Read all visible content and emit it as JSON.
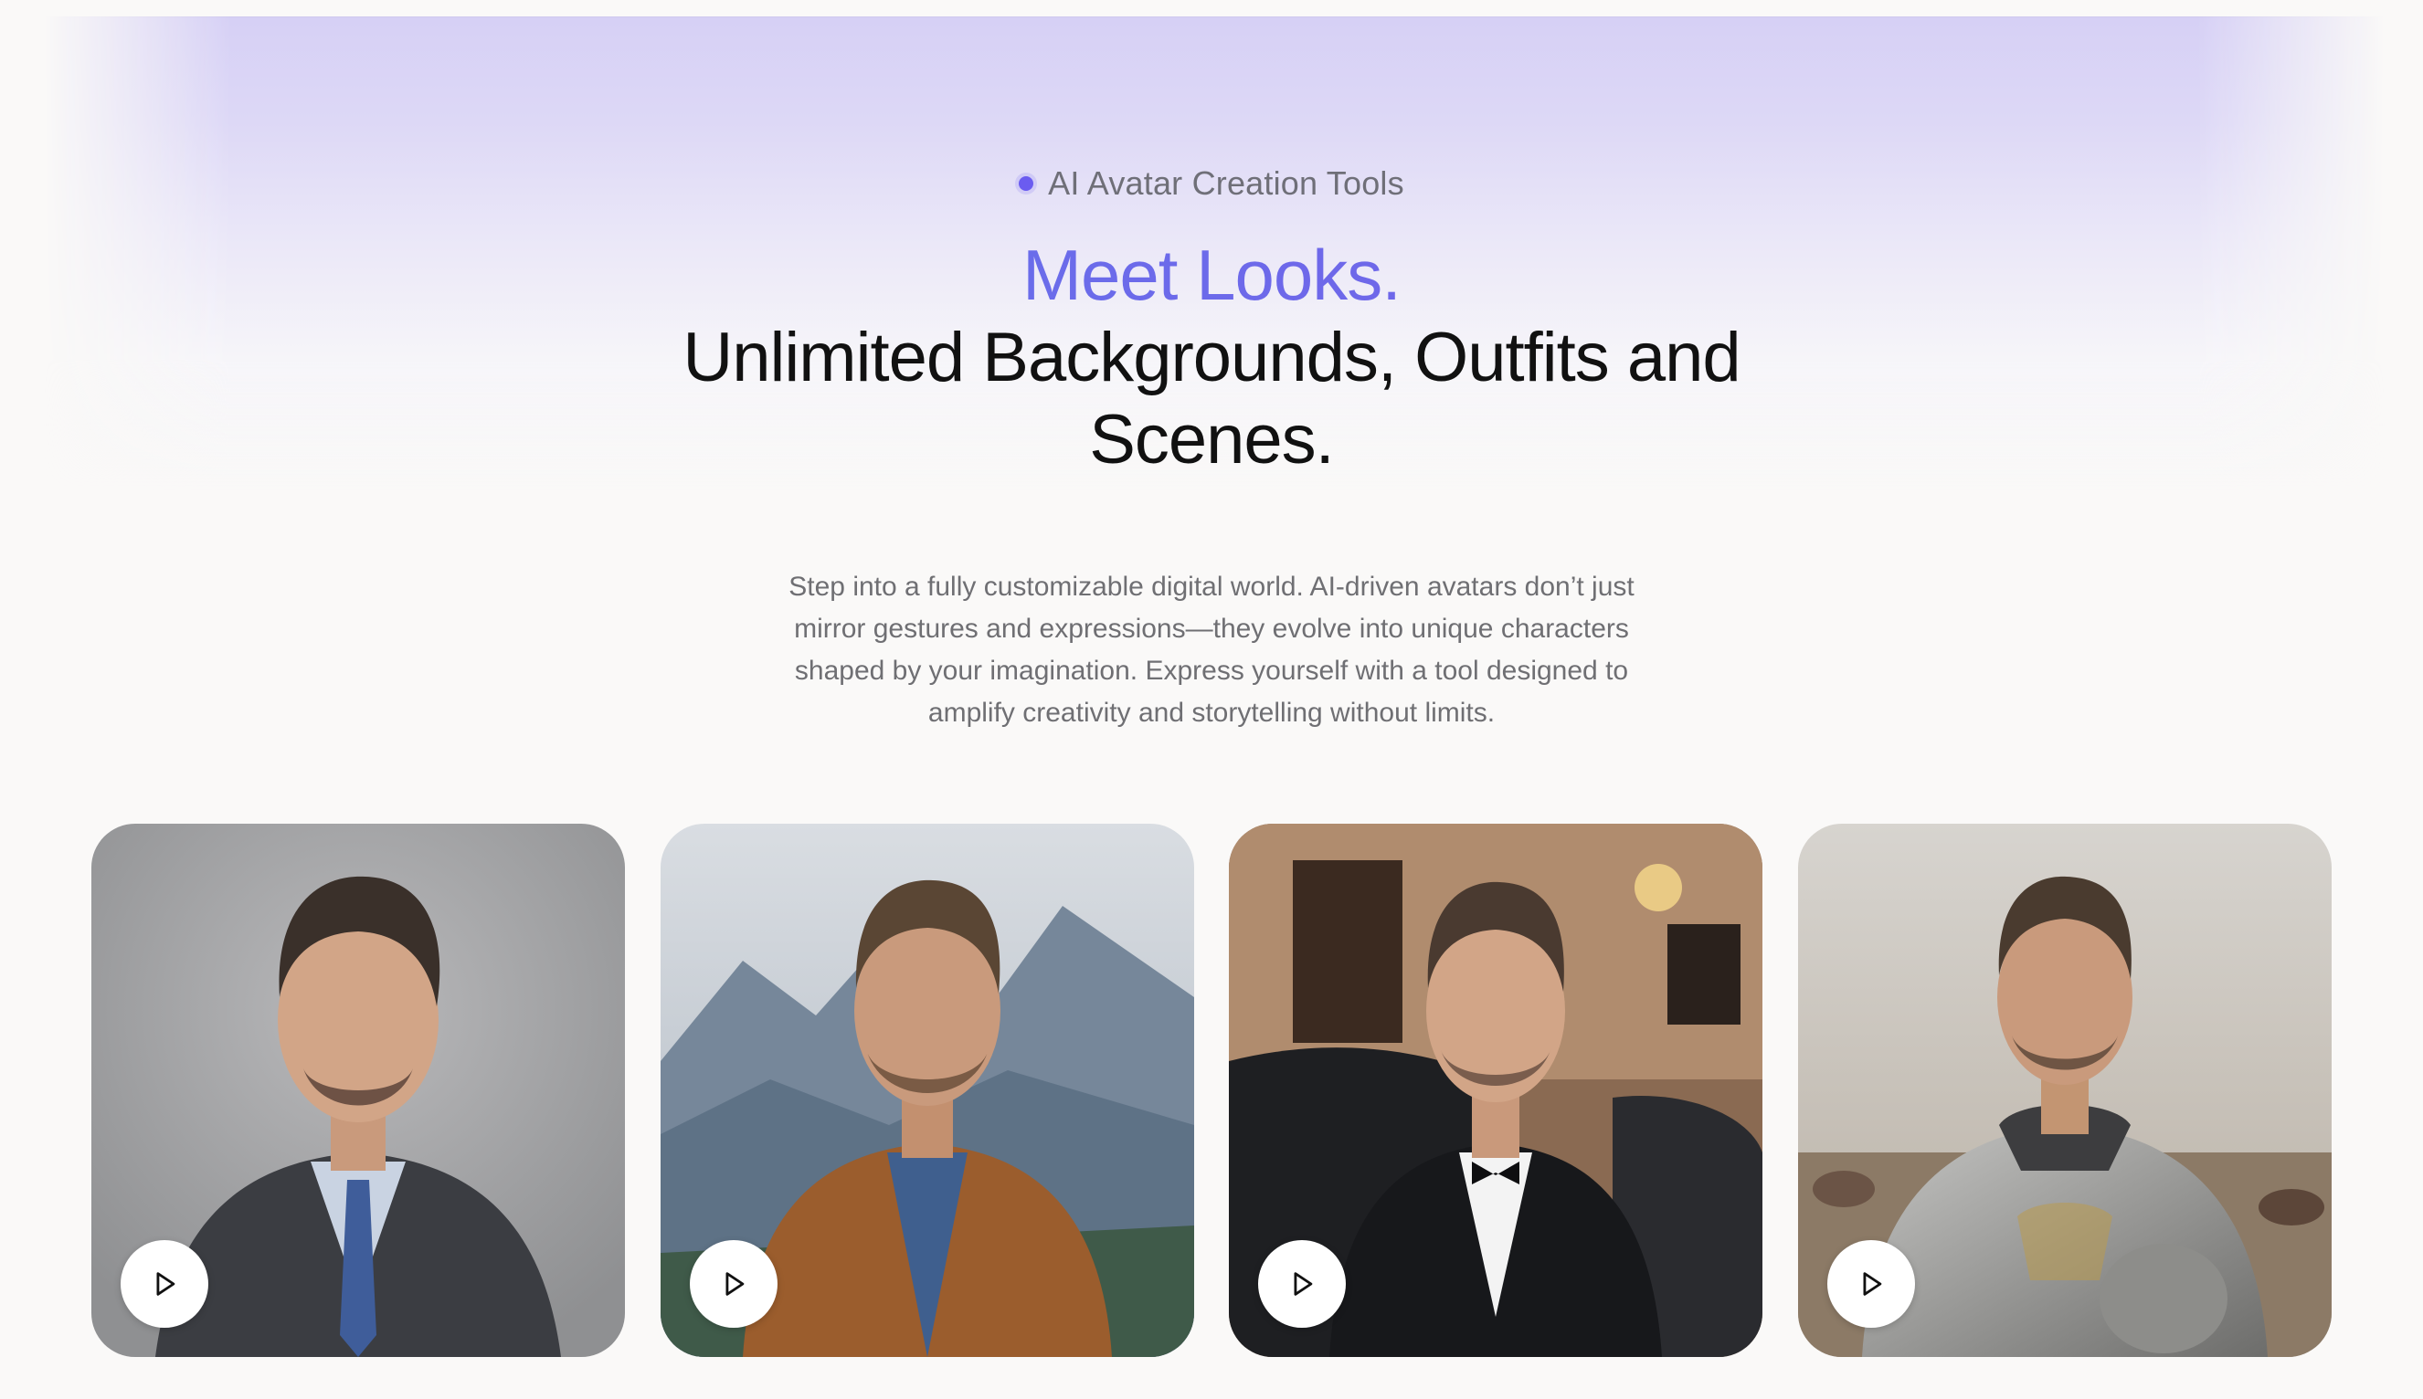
{
  "hero": {
    "eyebrow": "AI Avatar Creation Tools",
    "headline_accent": "Meet Looks.",
    "headline_main": "Unlimited Backgrounds, Outfits and Scenes.",
    "description": "Step into a fully customizable digital world. AI-driven avatars don’t just mirror gestures and expressions—they evolve into unique characters shaped by your imagination. Express yourself with a tool designed to amplify creativity and storytelling without limits."
  },
  "cards": [
    {
      "name": "avatar-look-business-suit",
      "icon": "play-icon"
    },
    {
      "name": "avatar-look-mountain-jacket",
      "icon": "play-icon"
    },
    {
      "name": "avatar-look-tuxedo",
      "icon": "play-icon"
    },
    {
      "name": "avatar-look-knight-armor",
      "icon": "play-icon"
    }
  ],
  "colors": {
    "accent_start": "#5f79eb",
    "accent_end": "#7a5ae8",
    "dot": "#6b5cf0",
    "background": "#faf9f8"
  }
}
